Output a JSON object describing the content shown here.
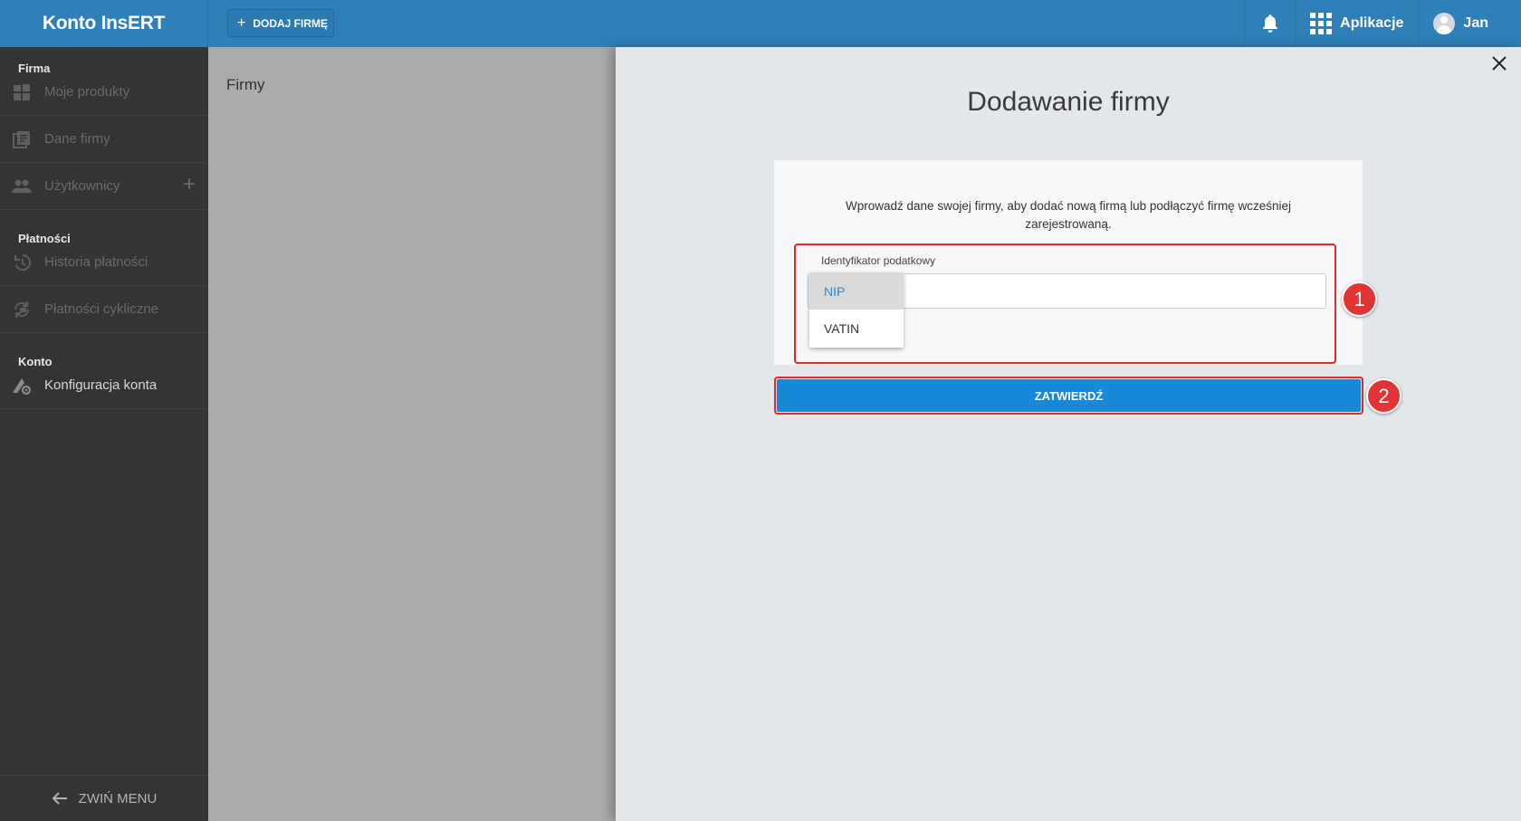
{
  "topbar": {
    "brand": "Konto InsERT",
    "add_company_label": "DODAJ FIRMĘ",
    "apps_label": "Aplikacje",
    "user_name": "Jan"
  },
  "sidebar": {
    "sections": [
      {
        "title": "Firma",
        "items": [
          {
            "label": "Moje produkty",
            "icon": "widgets-icon"
          },
          {
            "label": "Dane firmy",
            "icon": "document-list-icon"
          },
          {
            "label": "Użytkownicy",
            "icon": "users-icon"
          }
        ]
      },
      {
        "title": "Płatności",
        "items": [
          {
            "label": "Historia płatności",
            "icon": "history-icon"
          },
          {
            "label": "Płatności cykliczne",
            "icon": "recurring-payment-icon"
          }
        ]
      },
      {
        "title": "Konto",
        "items": [
          {
            "label": "Konfiguracja konta",
            "icon": "account-settings-icon"
          }
        ]
      }
    ],
    "collapse_label": "ZWIŃ MENU"
  },
  "background_page": {
    "title": "Firmy"
  },
  "modal": {
    "title": "Dodawanie firmy",
    "intro": "Wprowadź dane swojej firmy, aby dodać nową firmą lub podłączyć firmę wcześniej zarejestrowaną.",
    "field_label": "Identyfikator podatkowy",
    "tax_id_value": "",
    "dropdown_options": [
      "NIP",
      "VATIN"
    ],
    "selected_option": "NIP",
    "submit_label": "ZATWIERDŹ",
    "badges": [
      "1",
      "2"
    ]
  },
  "colors": {
    "topbar": "#2f7fb8",
    "sidebar": "#343434",
    "accent": "#1889d6",
    "highlight": "#e02a2a"
  }
}
